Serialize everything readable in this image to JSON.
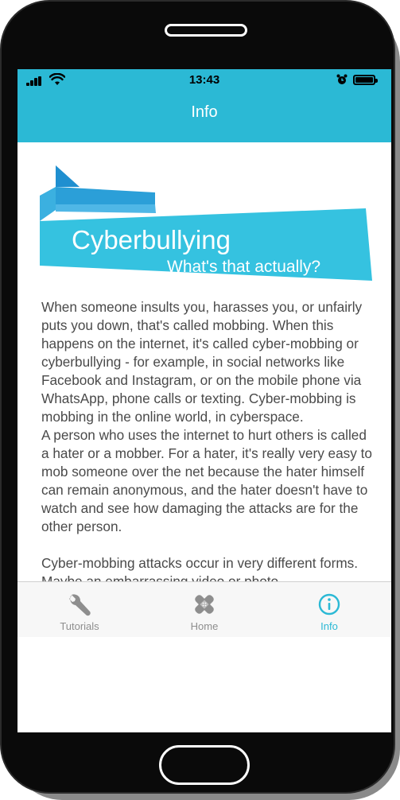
{
  "status_bar": {
    "time": "13:43",
    "icons": [
      "signal-icon",
      "wifi-icon",
      "alarm-icon",
      "battery-icon"
    ]
  },
  "nav": {
    "title": "Info"
  },
  "banner": {
    "title": "Cyberbullying",
    "subtitle": "What's that actually?"
  },
  "article": {
    "paragraphs": [
      "When someone insults you, harasses you, or unfairly puts you down, that's called mobbing. When this happens on the internet, it's called cyber-mobbing or cyberbullying - for example, in social networks like Facebook and Instagram, or on the mobile phone via WhatsApp, phone calls or texting. Cyber-mobbing is mobbing in the online world, in cyberspace.",
      "A person who uses the internet to hurt others is called a hater or a mobber. For a hater, it's really very easy to mob someone over the net because the hater himself can remain anonymous, and the hater doesn't have to watch and see how damaging the attacks are for the other person.",
      "Cyber-mobbing attacks occur in very different forms. Maybe an embarrassing video or photo"
    ]
  },
  "tabs": [
    {
      "label": "Tutorials",
      "icon": "wrench-icon",
      "active": false
    },
    {
      "label": "Home",
      "icon": "bandage-icon",
      "active": false
    },
    {
      "label": "Info",
      "icon": "info-icon",
      "active": true
    }
  ],
  "colors": {
    "accent": "#2bb9d5",
    "banner_dark": "#1f9fcb",
    "banner_light": "#35c2e0",
    "text": "#4a4a4a",
    "tab_inactive": "#8e8e8e"
  }
}
